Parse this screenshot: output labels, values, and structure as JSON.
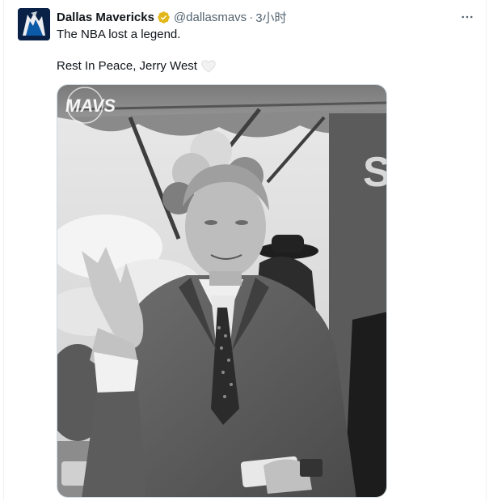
{
  "tweet": {
    "author_name": "Dallas Mavericks",
    "handle": "@dallasmavs",
    "separator": "·",
    "time_ago": "3小时",
    "text_line1": "The NBA lost a legend.",
    "text_line2": "Rest In Peace, Jerry West",
    "more_icon": "more-horizontal-icon",
    "verified_icon": "verified-gold-badge-icon",
    "heart_icon": "white-heart-emoji",
    "media": {
      "watermark": "MAVS",
      "banner_letter": "S"
    }
  },
  "colors": {
    "verified_gold": "#e2b719",
    "secondary_text": "#536471",
    "primary_text": "#0f1419",
    "avatar_blue": "#0a2147"
  }
}
